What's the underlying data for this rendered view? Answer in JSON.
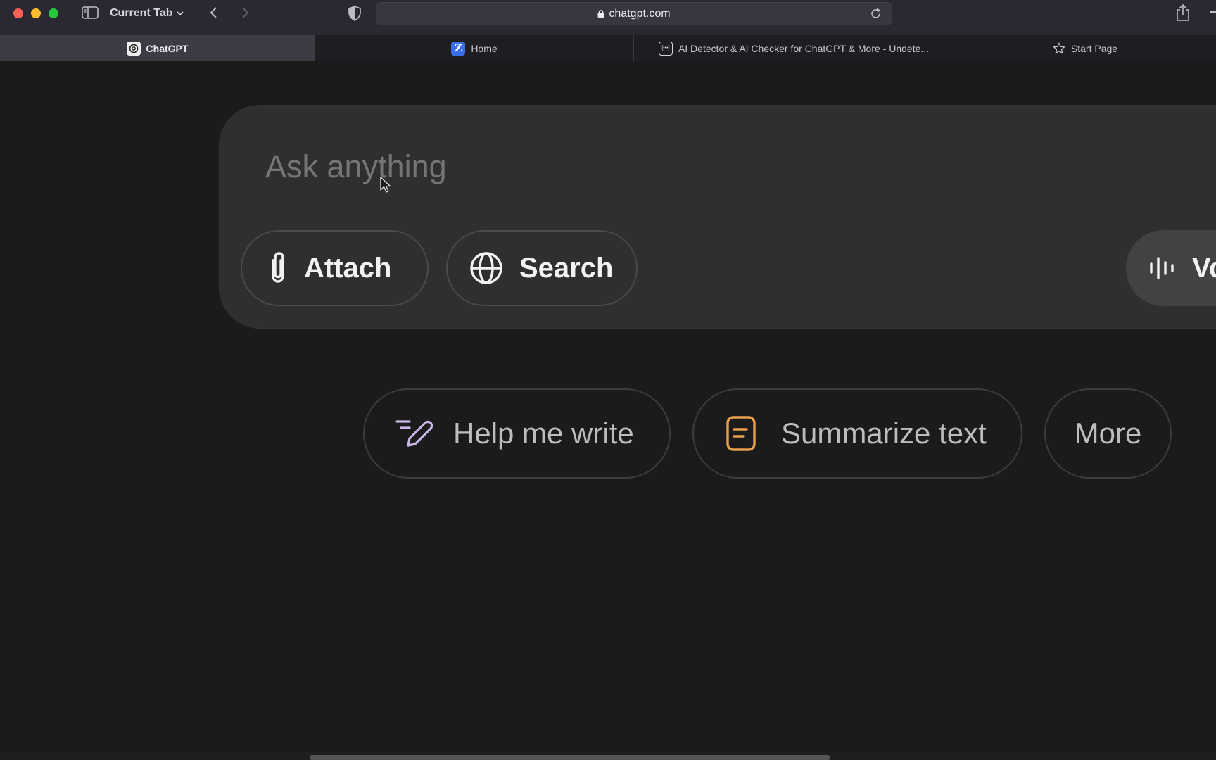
{
  "browser": {
    "current_tab_label": "Current Tab",
    "url": "chatgpt.com",
    "tabs": [
      {
        "label": "ChatGPT",
        "icon": "chatgpt-logo-icon",
        "active": true
      },
      {
        "label": "Home",
        "icon": "z-logo-icon",
        "active": false
      },
      {
        "label": "AI Detector & AI Checker for ChatGPT & More - Undete...",
        "icon": "detector-logo-icon",
        "active": false
      },
      {
        "label": "Start Page",
        "icon": "star-icon",
        "active": false
      }
    ]
  },
  "composer": {
    "placeholder": "Ask anything",
    "attach_label": "Attach",
    "search_label": "Search",
    "voice_label": "Vo"
  },
  "suggestions": [
    {
      "label": "Help me write",
      "icon": "pen-write-icon",
      "icon_color": "#c9b8e8"
    },
    {
      "label": "Summarize text",
      "icon": "document-icon",
      "icon_color": "#e8a04e"
    },
    {
      "label": "More"
    }
  ],
  "colors": {
    "background": "#1b1b1b",
    "composer": "#2f2f2f",
    "placeholder": "#9b9b9b"
  }
}
